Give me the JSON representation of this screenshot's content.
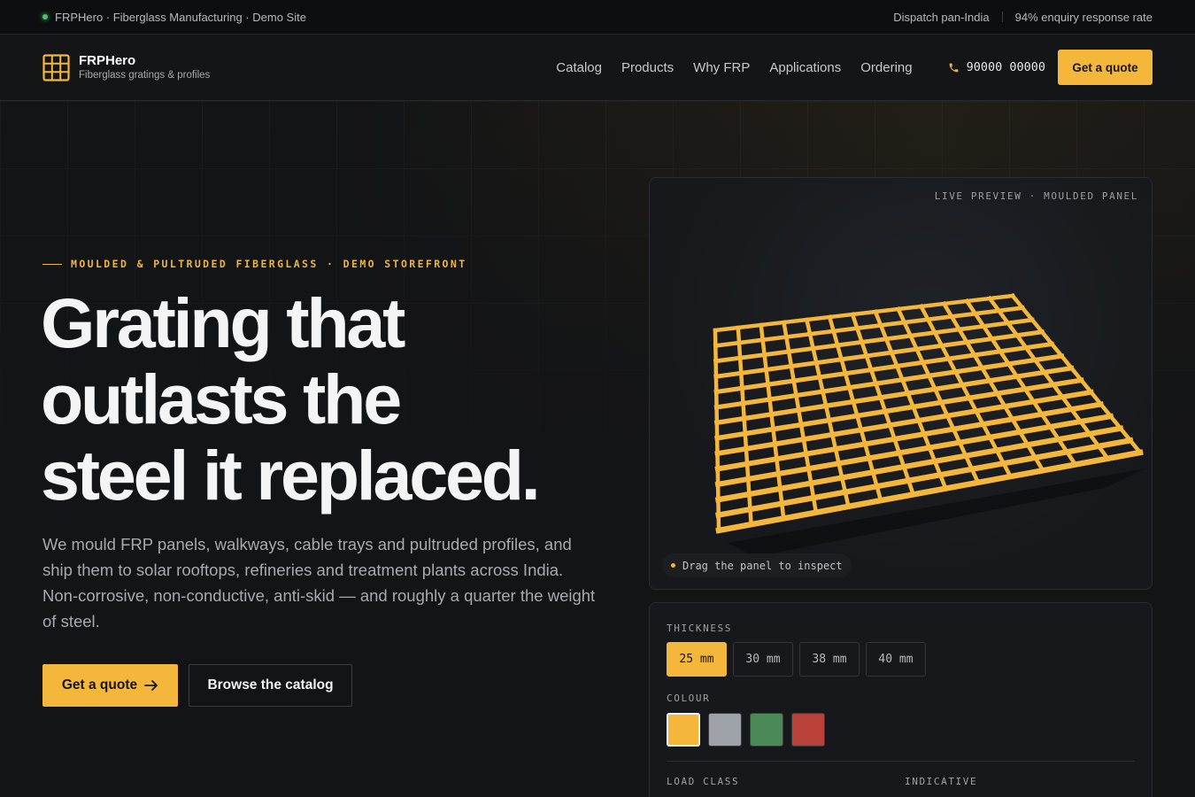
{
  "topbar": {
    "site_label": "FRPHero · Fiberglass Manufacturing · Demo Site",
    "dispatch": "Dispatch pan-India",
    "response_rate": "94% enquiry response rate"
  },
  "header": {
    "brand_name": "FRPHero",
    "brand_tagline": "Fiberglass gratings & profiles",
    "nav": [
      {
        "label": "Catalog"
      },
      {
        "label": "Products"
      },
      {
        "label": "Why FRP"
      },
      {
        "label": "Applications"
      },
      {
        "label": "Ordering"
      }
    ],
    "phone": "90000 00000",
    "cta_label": "Get a quote"
  },
  "hero": {
    "eyebrow": "MOULDED & PULTRUDED FIBERGLASS · DEMO STOREFRONT",
    "headline_line1": "Grating that",
    "headline_line2": "outlasts the",
    "headline_line3": "steel it replaced.",
    "lede": "We mould FRP panels, walkways, cable trays and pultruded profiles, and ship them to solar rooftops, refineries and treatment plants across India. Non-corrosive, non-conductive, anti-skid — and roughly a quarter the weight of steel.",
    "primary_cta": "Get a quote",
    "secondary_cta": "Browse the catalog"
  },
  "preview": {
    "label": "LIVE PREVIEW · MOULDED PANEL",
    "hint": "Drag the panel to inspect",
    "grating_color": "#f5b73b"
  },
  "config": {
    "thickness_label": "THICKNESS",
    "thickness_options": [
      "25 mm",
      "30 mm",
      "38 mm",
      "40 mm"
    ],
    "thickness_selected": "25 mm",
    "colour_label": "COLOUR",
    "colours": [
      "#f5b73b",
      "#9ea2a9",
      "#4b8a58",
      "#b8413a"
    ],
    "colour_selected": "#f5b73b",
    "load_class_label": "LOAD CLASS",
    "indicative_label": "INDICATIVE"
  },
  "colors": {
    "accent": "#f5b73b",
    "status_online": "#4cc36a",
    "background": "#131416"
  }
}
